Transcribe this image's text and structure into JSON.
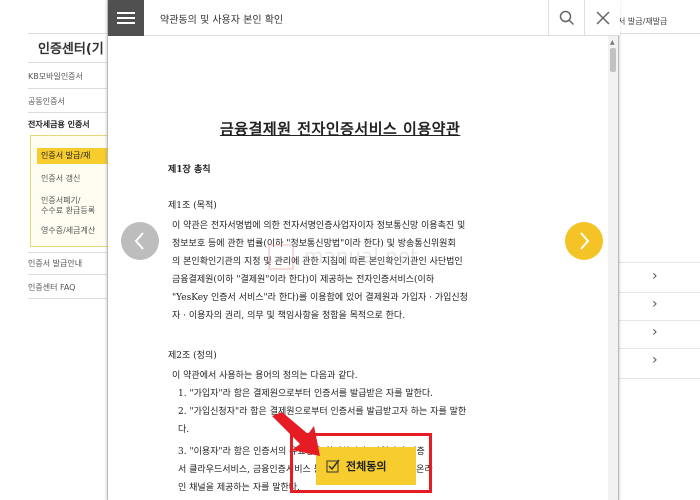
{
  "background": {
    "title": "인증센터(기",
    "top_right": "서 발급/재발급",
    "nav_items": [
      "KB모바일인증서",
      "공동인증서",
      "전자세금용 인증서"
    ],
    "sub_items": [
      "인증서 발급/재",
      "인증서 갱신",
      "인증서폐기/",
      "수수료 환급등록",
      "영수증/세금계산"
    ],
    "lower_items": [
      "인증서 발급안내",
      "인증센터 FAQ"
    ]
  },
  "modal": {
    "title": "약관동의 및 사용자 본인 확인",
    "icons": {
      "menu": "hamburger-menu-icon",
      "search": "search-icon",
      "close": "close-icon"
    }
  },
  "document": {
    "title": "금융결제원 전자인증서비스 이용약관",
    "chapter": "제1장 총칙",
    "article1_heading": "제1조 (목적)",
    "article1_lines": [
      "이 약관은 전자서명법에 의한 전자서명인증사업자이자 정보통신망 이용촉진 및",
      "정보보호 등에 관한 법률(이하 \"정보통신망법\"이라 한다) 및 방송통신위원회",
      "의 본인확인기관의 지정 및 관리에 관한 지침에 따른 본인확인기관인 사단법인",
      "금융결제원(이하    \"결제원\"이라   한다)이   제공하는    전자인증서비스(이하",
      "\"YesKey 인증서 서비스\"라 한다)를 이용함에 있어 결제원과 가입자 · 가입신청",
      "자 · 이용자의 권리, 의무 및 책임사항을 정함을 목적으로 한다."
    ],
    "article2_heading": "제2조 (정의)",
    "article2_intro": "이 약관에서 사용하는 용어의 정의는 다음과 같다.",
    "definitions": [
      "1.  \"가입자\"라 함은 결제원으로부터 인증서를 발급받은 자를 말한다.",
      "2.  \"가입신청자\"라 함은 결제원으로부터 인증서를 발급받고자 하는 자를 말한",
      "    다.",
      "3.  \"이용자\"라 함은 인증서의 유효성을 확인하거나, 가입자의 인증",
      "    서 클라우드서비스, 금융인증서비스 등 인증서비스 이용을 위한 온라",
      "    인 채널을 제공하는 자를 말한다."
    ]
  },
  "agree_button": {
    "label": "전체동의"
  },
  "watermark": {
    "text": "manual.net"
  },
  "colors": {
    "accent": "#f6cc2e",
    "highlight": "#e51c23",
    "header_menu": "#505050"
  }
}
